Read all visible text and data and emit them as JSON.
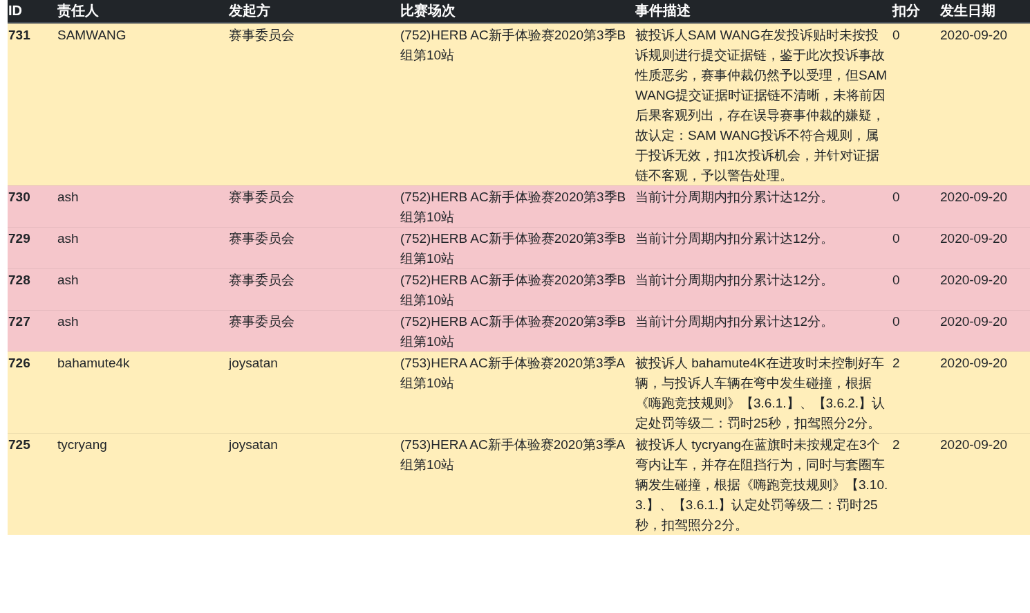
{
  "table": {
    "columns": [
      "ID",
      "责任人",
      "发起方",
      "比赛场次",
      "事件描述",
      "扣分",
      "发生日期"
    ],
    "rows": [
      {
        "color": "#ffeeba",
        "cells": [
          "731",
          "SAMWANG",
          "赛事委员会",
          "(752)HERB AC新手体验赛2020第3季B组第10站",
          "被投诉人SAM WANG在发投诉贴时未按投诉规则进行提交证据链，鉴于此次投诉事故性质恶劣，赛事仲裁仍然予以受理，但SAM WANG提交证据时证据链不清晰，未将前因后果客观列出，存在误导赛事仲裁的嫌疑，故认定：SAM WANG投诉不符合规则，属于投诉无效，扣1次投诉机会，并针对证据链不客观，予以警告处理。",
          "0",
          "2020-09-20"
        ]
      },
      {
        "color": "#f5c6cb",
        "cells": [
          "730",
          "ash",
          "赛事委员会",
          "(752)HERB AC新手体验赛2020第3季B组第10站",
          "当前计分周期内扣分累计达12分。",
          "0",
          "2020-09-20"
        ]
      },
      {
        "color": "#f5c6cb",
        "cells": [
          "729",
          "ash",
          "赛事委员会",
          "(752)HERB AC新手体验赛2020第3季B组第10站",
          "当前计分周期内扣分累计达12分。",
          "0",
          "2020-09-20"
        ]
      },
      {
        "color": "#f5c6cb",
        "cells": [
          "728",
          "ash",
          "赛事委员会",
          "(752)HERB AC新手体验赛2020第3季B组第10站",
          "当前计分周期内扣分累计达12分。",
          "0",
          "2020-09-20"
        ]
      },
      {
        "color": "#f5c6cb",
        "cells": [
          "727",
          "ash",
          "赛事委员会",
          "(752)HERB AC新手体验赛2020第3季B组第10站",
          "当前计分周期内扣分累计达12分。",
          "0",
          "2020-09-20"
        ]
      },
      {
        "color": "#ffeeba",
        "cells": [
          "726",
          "bahamute4k",
          "joysatan",
          "(753)HERA AC新手体验赛2020第3季A组第10站",
          "被投诉人 bahamute4K在进攻时未控制好车辆，与投诉人车辆在弯中发生碰撞，根据《嗨跑竞技规则》【3.6.1.】、【3.6.2.】认定处罚等级二：罚时25秒，扣驾照分2分。",
          "2",
          "2020-09-20"
        ]
      },
      {
        "color": "#ffeeba",
        "cells": [
          "725",
          "tycryang",
          "joysatan",
          "(753)HERA AC新手体验赛2020第3季A组第10站",
          "被投诉人 tycryang在蓝旗时未按规定在3个弯内让车，并存在阻挡行为，同时与套圈车辆发生碰撞，根据《嗨跑竞技规则》【3.10.3.】、【3.6.1.】认定处罚等级二：罚时25秒，扣驾照分2分。",
          "2",
          "2020-09-20"
        ]
      }
    ]
  }
}
